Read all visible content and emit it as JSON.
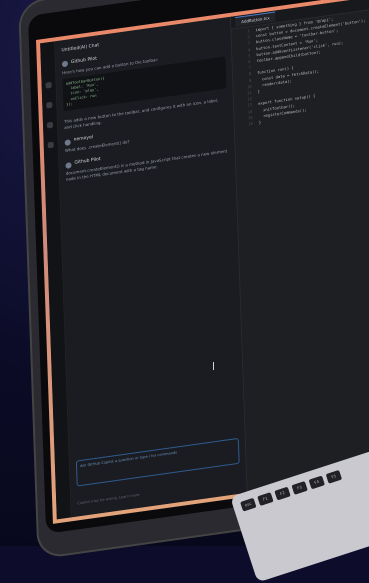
{
  "window": {
    "tab_name": "AddButton.tsx"
  },
  "chat": {
    "title": "Untitled(AI) Chat",
    "messages": [
      {
        "author": "Github Pilot",
        "text": "Here's how you can add a button to the toolbar:"
      },
      {
        "author": "Github Pilot",
        "text": "This adds a new button to the toolbar, and configures it with an icon, a label, and click handling."
      },
      {
        "author": "nemoyel",
        "text": "What does .createElement() do?"
      },
      {
        "author": "Github Pilot",
        "text": "document.createElement() is a method in JavaScript that creates a new element node in the HTML document with a tag name."
      }
    ],
    "code_snippet": "addToolbarButton({\n  label: 'Run',\n  icon: 'play',\n  onClick: run\n});",
    "input_placeholder": "Ask GitHub Copilot a question or type / for commands",
    "footer_hint": "Copilot may be wrong. Learn more"
  },
  "editor": {
    "lines": [
      {
        "n": "1",
        "code": "import { something } from '@/api';"
      },
      {
        "n": "2",
        "code": "const button = document.createElement('button');"
      },
      {
        "n": "3",
        "code": "button.className = 'toolbar-button';"
      },
      {
        "n": "4",
        "code": "button.textContent = 'Run';"
      },
      {
        "n": "5",
        "code": "button.addEventListener('click', run);"
      },
      {
        "n": "6",
        "code": "toolbar.appendChild(button);"
      },
      {
        "n": "7",
        "code": ""
      },
      {
        "n": "8",
        "code": "function run() {"
      },
      {
        "n": "9",
        "code": "  const data = fetchData();"
      },
      {
        "n": "10",
        "code": "  render(data);"
      },
      {
        "n": "11",
        "code": "}"
      },
      {
        "n": "12",
        "code": ""
      },
      {
        "n": "13",
        "code": "export function setup() {"
      },
      {
        "n": "14",
        "code": "  initToolbar();"
      },
      {
        "n": "15",
        "code": "  registerCommands();"
      },
      {
        "n": "16",
        "code": "}"
      }
    ]
  },
  "colors": {
    "accent": "#e9896a",
    "background": "#0d0d2b",
    "editor": "#1e1f22"
  },
  "keyboard": {
    "keys": [
      "esc",
      "F1",
      "F2",
      "F3",
      "F4",
      "F5"
    ]
  }
}
